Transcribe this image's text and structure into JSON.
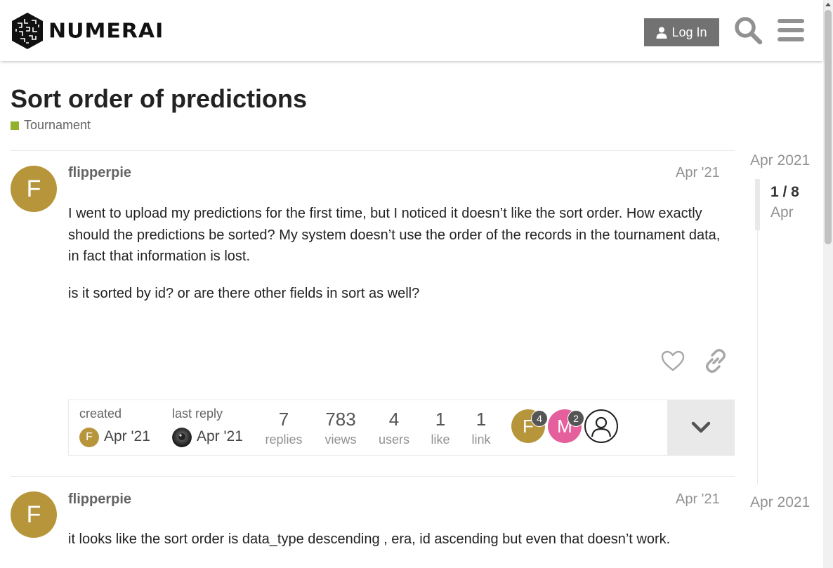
{
  "header": {
    "logo_text": "NUMERAI",
    "login_label": "Log In"
  },
  "topic": {
    "title": "Sort order of predictions",
    "category": "Tournament",
    "category_color": "#92b12c"
  },
  "posts": [
    {
      "avatar_letter": "F",
      "username": "flipperpie",
      "date": "Apr '21",
      "paragraphs": [
        "I went to upload my predictions for the first time, but I noticed it doesn’t like the sort order. How exactly should the predictions be sorted? My system doesn’t use the order of the records in the tournament data, in fact that information is lost.",
        "is it sorted by id? or are there other fields in sort as well?"
      ]
    },
    {
      "avatar_letter": "F",
      "username": "flipperpie",
      "date": "Apr '21",
      "paragraphs": [
        "it looks like the sort order is data_type descending , era, id ascending but even that doesn’t work."
      ]
    }
  ],
  "topic_map": {
    "created_label": "created",
    "created_date": "Apr '21",
    "last_reply_label": "last reply",
    "last_reply_date": "Apr '21",
    "stats": [
      {
        "value": "7",
        "label": "replies"
      },
      {
        "value": "783",
        "label": "views"
      },
      {
        "value": "4",
        "label": "users"
      },
      {
        "value": "1",
        "label": "like"
      },
      {
        "value": "1",
        "label": "link"
      }
    ],
    "participants": [
      {
        "letter": "F",
        "count": "4",
        "color": "#b7953b"
      },
      {
        "letter": "M",
        "count": "2",
        "color": "#e45f9c"
      },
      {
        "letter": "",
        "count": "",
        "color": "#ffffff"
      }
    ]
  },
  "timeline": {
    "start_date": "Apr 2021",
    "progress": "1 / 8",
    "current_month": "Apr",
    "end_date": "Apr 2021"
  },
  "icons": {
    "search": "search-icon",
    "menu": "hamburger-icon",
    "user": "user-icon",
    "like": "heart-icon",
    "share": "link-icon",
    "expand": "chevron-down-icon"
  }
}
